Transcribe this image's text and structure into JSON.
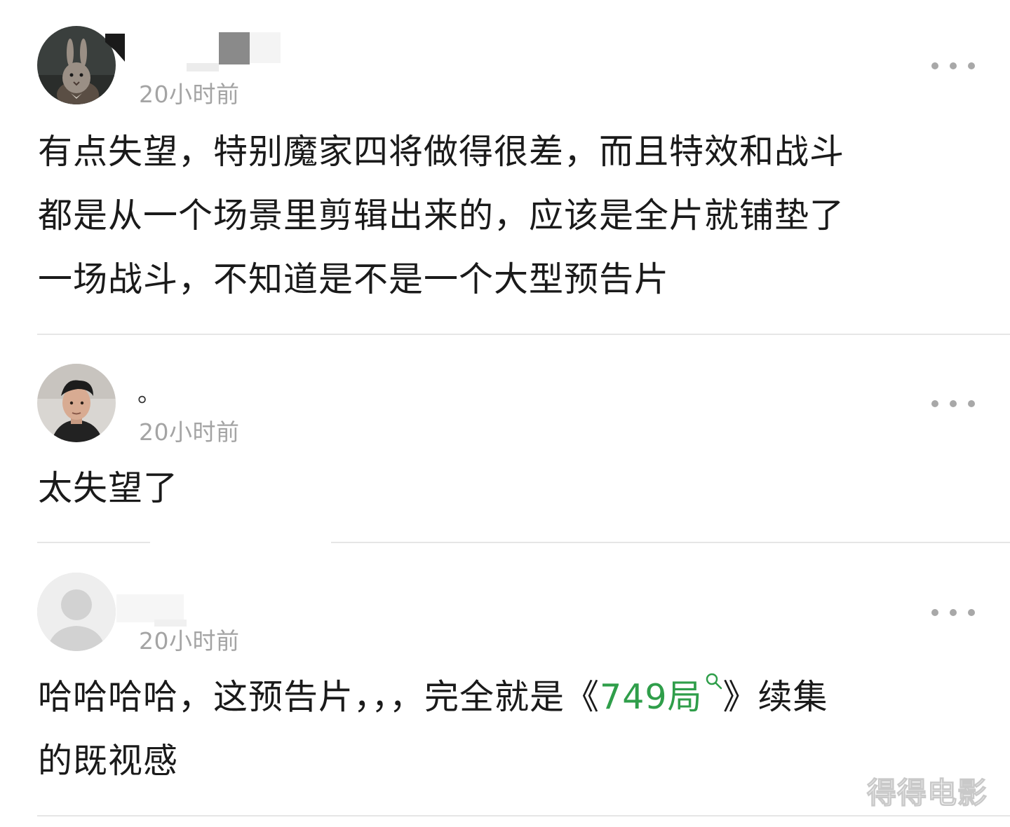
{
  "comments": [
    {
      "username": "",
      "time": "20小时前",
      "text": "有点失望，特别魔家四将做得很差，而且特效和战斗\n都是从一个场景里剪辑出来的，应该是全片就铺垫了\n一场战斗，不知道是不是一个大型预告片"
    },
    {
      "username": "。",
      "time": "20小时前",
      "text": "太失望了"
    },
    {
      "username": "",
      "time": "20小时前",
      "text_before": "哈哈哈哈，这预告片，，，完全就是《",
      "topic": "749局",
      "text_after": "》续集\n的既视感"
    }
  ],
  "watermark": "得得电影",
  "colors": {
    "topic_link": "#2f9e4a",
    "timestamp": "#a4a4a4",
    "divider": "#e6e6e6"
  },
  "icons": {
    "more": "more-horizontal-icon",
    "search": "search-icon"
  }
}
